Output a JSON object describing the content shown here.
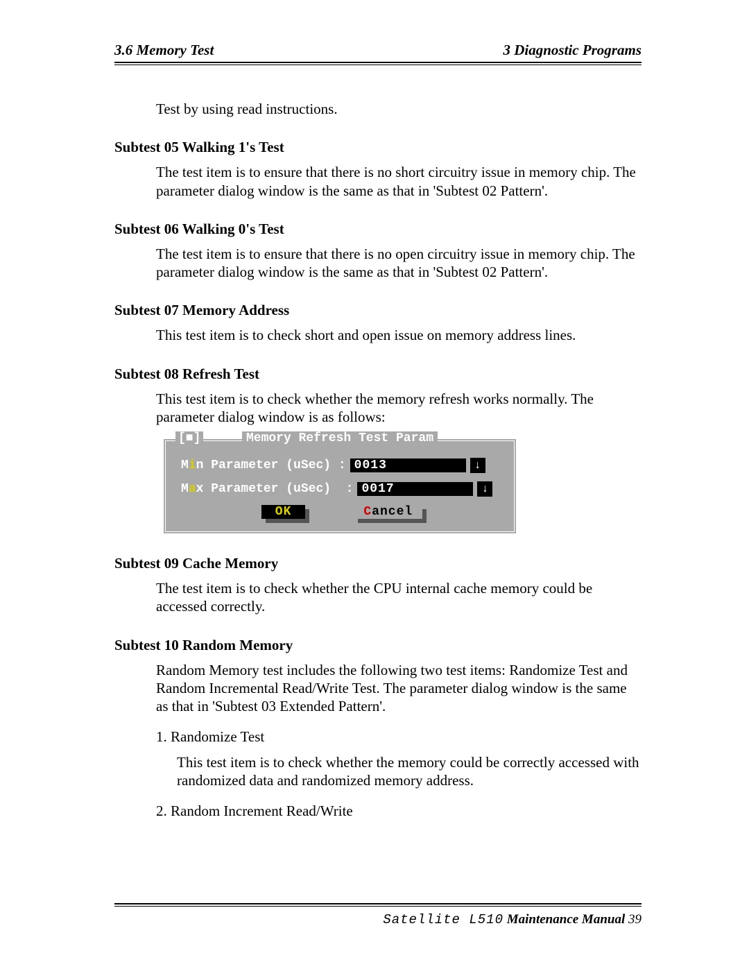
{
  "header": {
    "left": "3.6 Memory Test",
    "right": "3  Diagnostic Programs"
  },
  "intro": "Test by using read instructions.",
  "subtests": {
    "s05": {
      "title": "Subtest 05  Walking 1's Test",
      "body": "The test item is to ensure that there is no short circuitry issue in memory chip. The parameter dialog window is the same as that in 'Subtest 02 Pattern'."
    },
    "s06": {
      "title": "Subtest 06  Walking 0's Test",
      "body": "The test item is to ensure that there is no open circuitry issue in memory chip. The parameter dialog window is the same as that in 'Subtest 02 Pattern'."
    },
    "s07": {
      "title": "Subtest 07  Memory Address",
      "body": "This test item is to check short and open issue on memory address lines."
    },
    "s08": {
      "title": "Subtest 08  Refresh Test",
      "body": "This test item is to check whether the memory refresh works normally. The parameter dialog window is as follows:"
    },
    "s09": {
      "title": "Subtest 09  Cache Memory",
      "body": "The test item is to check whether the CPU internal cache memory could be accessed correctly."
    },
    "s10": {
      "title": "Subtest 10  Random Memory",
      "body": "Random Memory test includes the following two test items: Randomize Test and Random Incremental Read/Write Test. The parameter dialog window is the same as that in 'Subtest 03 Extended Pattern'.",
      "item1_label": "1.   Randomize Test",
      "item1_body": "This test item is to check whether the memory could be correctly accessed with randomized data and randomized memory address.",
      "item2_label": "2.   Random Increment Read/Write"
    }
  },
  "dialog": {
    "close": "[■]",
    "title": "Memory Refresh Test Param",
    "min_label_pre": "M",
    "min_label_hot": "i",
    "min_label_post": "n Parameter (uSec) :",
    "min_value": "0013",
    "max_label_pre": "M",
    "max_label_hot": "a",
    "max_label_post": "x Parameter (uSec)  :",
    "max_value": "0017",
    "arrow": "↓",
    "ok": "OK",
    "cancel_hot": "C",
    "cancel_rest": "ancel"
  },
  "footer": {
    "model": "Satellite L510",
    "mm": " Maintenance Manual",
    "page": " 39"
  }
}
